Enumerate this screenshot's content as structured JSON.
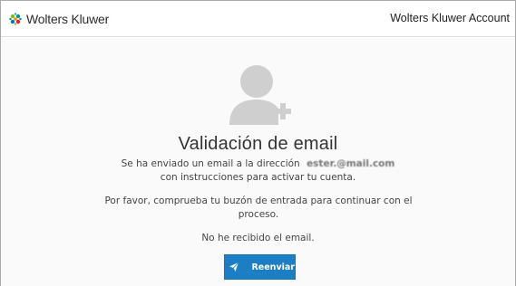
{
  "header": {
    "logo_text": "Wolters Kluwer",
    "account_title": "Wolters Kluwer Account"
  },
  "main": {
    "title": "Validación de email",
    "sent_text": "Se ha enviado un email a la dirección",
    "email": "ester.@mail.com",
    "instructions": "con instrucciones para activar tu cuenta.",
    "check_inbox": "Por favor, comprueba tu buzón de entrada para continuar con el proceso.",
    "not_received": "No he recibido el email.",
    "resend_label": "Reenviar"
  },
  "icons": {
    "logo": "wolters-kluwer-logo",
    "user_add": "user-add-icon",
    "send": "paper-plane-icon"
  },
  "colors": {
    "primary": "#1c7fc5",
    "icon_gray": "#cfcfcf"
  }
}
